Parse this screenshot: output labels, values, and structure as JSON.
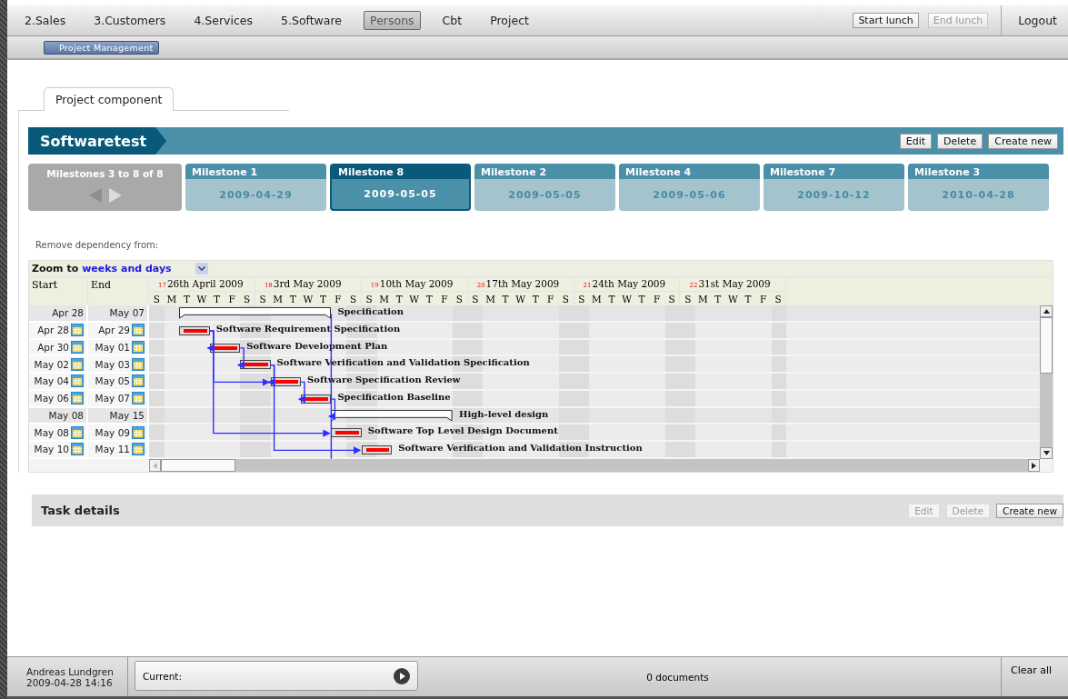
{
  "nav": {
    "items": [
      {
        "label": "2.Sales",
        "selected": false
      },
      {
        "label": "3.Customers",
        "selected": false
      },
      {
        "label": "4.Services",
        "selected": false
      },
      {
        "label": "5.Software",
        "selected": false
      },
      {
        "label": "Persons",
        "selected": true
      },
      {
        "label": "Cbt",
        "selected": false
      },
      {
        "label": "Project",
        "selected": false
      }
    ],
    "lunch_buttons": [
      {
        "label": "Start lunch",
        "disabled": false
      },
      {
        "label": "End lunch",
        "disabled": true
      }
    ],
    "logout": "Logout"
  },
  "breadcrumb": "Project Management",
  "tab": "Project component",
  "project": {
    "title": "Softwaretest",
    "buttons": [
      "Edit",
      "Delete",
      "Create new"
    ]
  },
  "milestones": {
    "pager": {
      "label": "Milestones 3 to 8 of 8",
      "prev_disabled": false,
      "next_disabled": true
    },
    "items": [
      {
        "name": "Milestone 1",
        "date": "2009-04-29",
        "selected": false
      },
      {
        "name": "Milestone 8",
        "date": "2009-05-05",
        "selected": true
      },
      {
        "name": "Milestone 2",
        "date": "2009-05-05",
        "selected": false
      },
      {
        "name": "Milestone 4",
        "date": "2009-05-06",
        "selected": false
      },
      {
        "name": "Milestone 7",
        "date": "2009-10-12",
        "selected": false
      },
      {
        "name": "Milestone 3",
        "date": "2010-04-28",
        "selected": false
      }
    ]
  },
  "remove_dependency_label": "Remove dependency from:",
  "gantt": {
    "zoom": {
      "label": "Zoom to",
      "value": "weeks and days"
    },
    "columns": [
      "Start",
      "End"
    ],
    "weeks": [
      {
        "number": "17",
        "label": "26th April 2009",
        "days": [
          "S",
          "M",
          "T",
          "W",
          "T",
          "F",
          "S"
        ]
      },
      {
        "number": "18",
        "label": "3rd May 2009",
        "days": [
          "S",
          "M",
          "T",
          "W",
          "T",
          "F",
          "S"
        ]
      },
      {
        "number": "19",
        "label": "10th May 2009",
        "days": [
          "S",
          "M",
          "T",
          "W",
          "T",
          "F",
          "S"
        ]
      },
      {
        "number": "20",
        "label": "17th May 2009",
        "days": [
          "S",
          "M",
          "T",
          "W",
          "T",
          "F",
          "S"
        ]
      },
      {
        "number": "21",
        "label": "24th May 2009",
        "days": [
          "S",
          "M",
          "T",
          "W",
          "T",
          "F",
          "S"
        ]
      },
      {
        "number": "22",
        "label": "31st May 2009",
        "days": [
          "S",
          "M",
          "T",
          "W",
          "T",
          "F",
          "S"
        ]
      }
    ],
    "rows": [
      {
        "kind": "summary",
        "start": "Apr 28",
        "end": "May 07",
        "name": "Specification"
      },
      {
        "kind": "task",
        "start": "Apr 28",
        "end": "Apr 29",
        "name": "Software Requirement Specification"
      },
      {
        "kind": "task",
        "start": "Apr 30",
        "end": "May 01",
        "name": "Software Development Plan"
      },
      {
        "kind": "task",
        "start": "May 02",
        "end": "May 03",
        "name": "Software Verification and Validation Specification"
      },
      {
        "kind": "task",
        "start": "May 04",
        "end": "May 05",
        "name": "Software Specification Review"
      },
      {
        "kind": "task",
        "start": "May 06",
        "end": "May 07",
        "name": "Specification Baseline"
      },
      {
        "kind": "summary",
        "start": "May 08",
        "end": "May 15",
        "name": "High-level design"
      },
      {
        "kind": "task",
        "start": "May 08",
        "end": "May 09",
        "name": "Software Top Level Design Document"
      },
      {
        "kind": "task",
        "start": "May 10",
        "end": "May 11",
        "name": "Software Verification and Validation Instruction"
      }
    ]
  },
  "task_details": {
    "title": "Task details",
    "buttons": [
      {
        "label": "Edit",
        "disabled": true
      },
      {
        "label": "Delete",
        "disabled": true
      },
      {
        "label": "Create new",
        "disabled": false
      }
    ]
  },
  "status_bar": {
    "user": "Andreas Lundgren",
    "datetime": "2009-04-28 14:16",
    "current_label": "Current:",
    "documents": "0 documents",
    "clear": "Clear all"
  }
}
